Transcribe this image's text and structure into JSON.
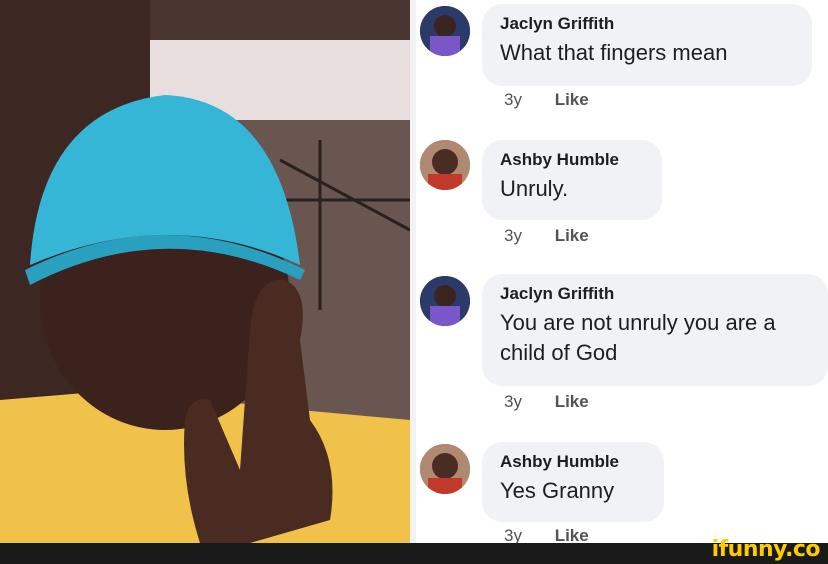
{
  "comments": [
    {
      "author": "Jaclyn Griffith",
      "text": "What that fingers mean",
      "age": "3y",
      "like": "Like"
    },
    {
      "author": "Ashby Humble",
      "text": "Unruly.",
      "age": "3y",
      "like": "Like"
    },
    {
      "author": "Jaclyn Griffith",
      "text": "You are not unruly you are a child of God",
      "age": "3y",
      "like": "Like"
    },
    {
      "author": "Ashby Humble",
      "text": "Yes Granny",
      "age": "3y",
      "like": "Like"
    }
  ],
  "brand": "ifunny.co",
  "colors": {
    "bubble": "#f0f2f5",
    "brand": "#ffcc00",
    "hat": "#35b6d6",
    "shirt": "#f1c24a"
  }
}
